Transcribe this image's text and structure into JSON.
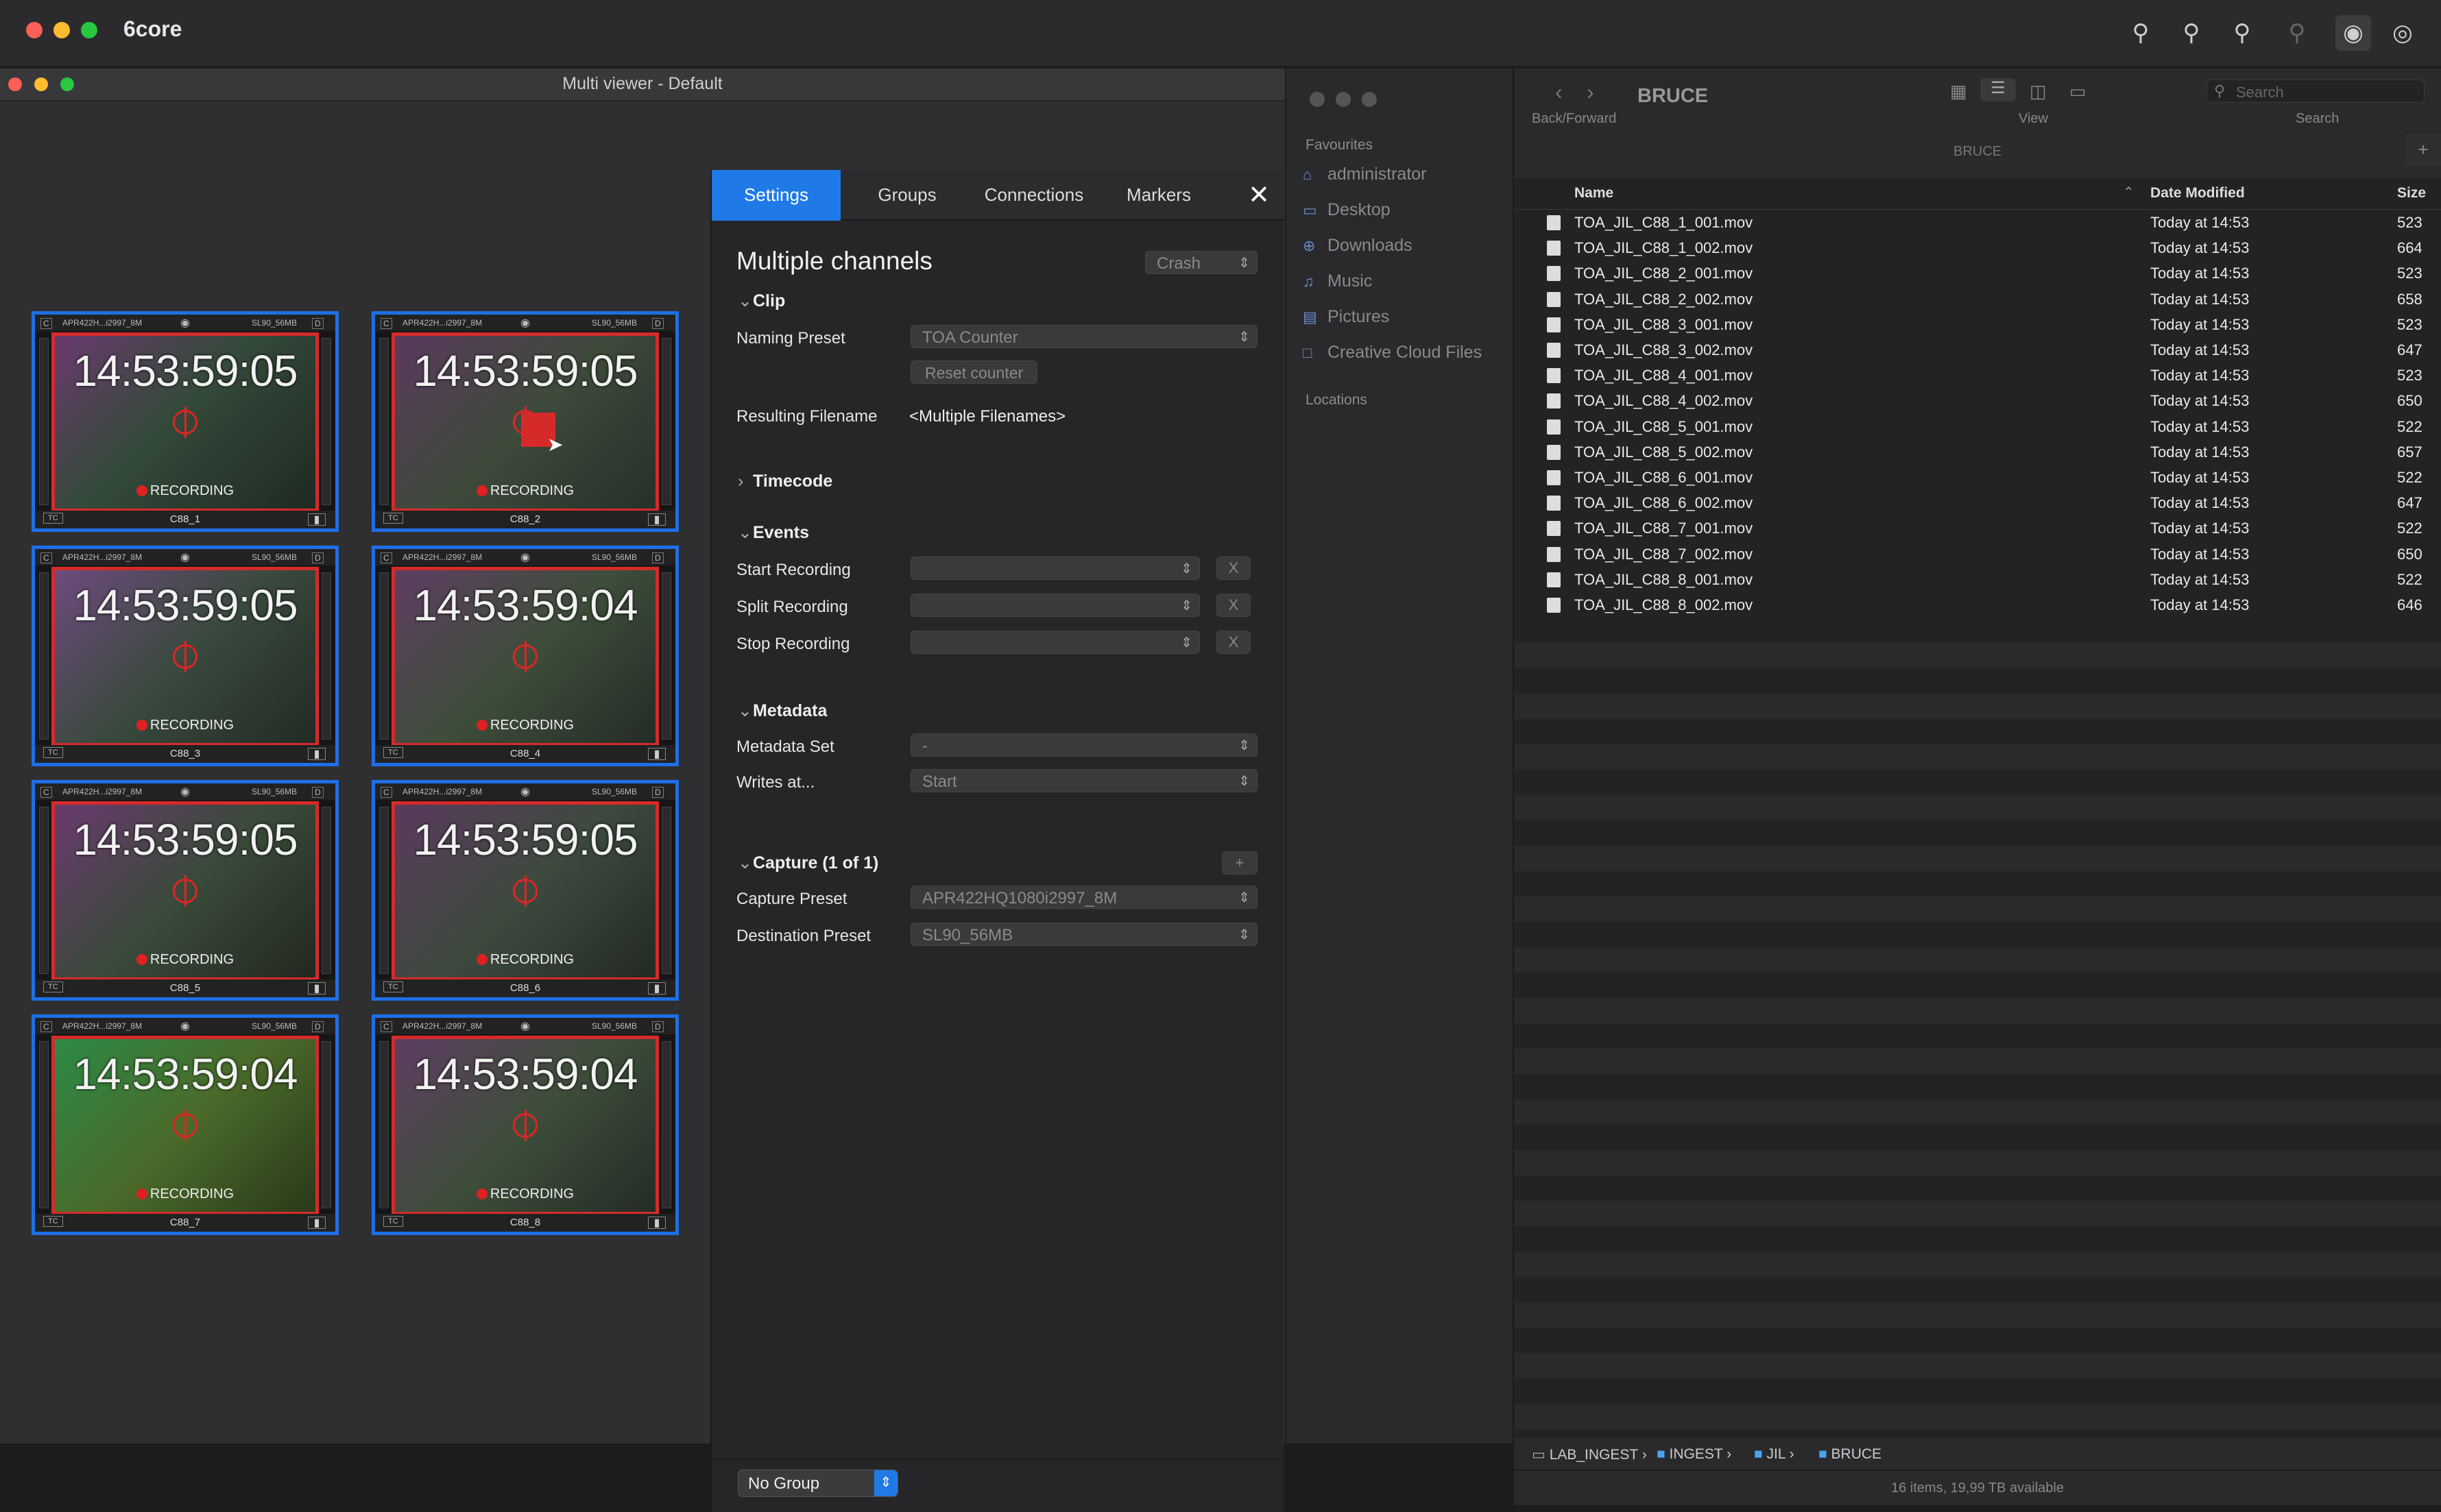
{
  "app": {
    "name": "6core"
  },
  "colors": {
    "accent": "#1f7ae8",
    "recording": "#d62a2a",
    "tile_border": "#1e6fe6"
  },
  "toolbar_icons": [
    "zoom-out-icon",
    "zoom-in-icon",
    "zoom-in-alt-icon",
    "zoom-out-alt-icon",
    "fingerprint-icon",
    "binoculars-icon"
  ],
  "multiviewer": {
    "title": "Multi viewer - Default",
    "tiles": [
      {
        "preset": "APR422H...i2997_8M",
        "dest": "SL90_56MB",
        "badge": "D",
        "timecode": "14:53:59:05",
        "status": "RECORDING",
        "name": "C88_1",
        "tc_label": "TC"
      },
      {
        "preset": "APR422H...i2997_8M",
        "dest": "SL90_56MB",
        "badge": "D",
        "timecode": "14:53:59:05",
        "status": "RECORDING",
        "name": "C88_2",
        "tc_label": "TC"
      },
      {
        "preset": "APR422H...i2997_8M",
        "dest": "SL90_56MB",
        "badge": "D",
        "timecode": "14:53:59:05",
        "status": "RECORDING",
        "name": "C88_3",
        "tc_label": "TC"
      },
      {
        "preset": "APR422H...i2997_8M",
        "dest": "SL90_56MB",
        "badge": "D",
        "timecode": "14:53:59:04",
        "status": "RECORDING",
        "name": "C88_4",
        "tc_label": "TC"
      },
      {
        "preset": "APR422H...i2997_8M",
        "dest": "SL90_56MB",
        "badge": "D",
        "timecode": "14:53:59:05",
        "status": "RECORDING",
        "name": "C88_5",
        "tc_label": "TC"
      },
      {
        "preset": "APR422H...i2997_8M",
        "dest": "SL90_56MB",
        "badge": "D",
        "timecode": "14:53:59:05",
        "status": "RECORDING",
        "name": "C88_6",
        "tc_label": "TC"
      },
      {
        "preset": "APR422H...i2997_8M",
        "dest": "SL90_56MB",
        "badge": "D",
        "timecode": "14:53:59:04",
        "status": "RECORDING",
        "name": "C88_7",
        "tc_label": "TC"
      },
      {
        "preset": "APR422H...i2997_8M",
        "dest": "SL90_56MB",
        "badge": "D",
        "timecode": "14:53:59:04",
        "status": "RECORDING",
        "name": "C88_8",
        "tc_label": "TC"
      }
    ]
  },
  "settings": {
    "tabs": [
      "Settings",
      "Groups",
      "Connections",
      "Markers"
    ],
    "title": "Multiple channels",
    "crash_select": "Crash",
    "clip": {
      "header": "Clip",
      "naming_preset_label": "Naming Preset",
      "naming_preset_value": "TOA Counter",
      "reset_counter": "Reset counter",
      "resulting_filename_label": "Resulting Filename",
      "resulting_filename_value": "<Multiple Filenames>"
    },
    "timecode": {
      "header": "Timecode"
    },
    "events": {
      "header": "Events",
      "start": "Start Recording",
      "split": "Split Recording",
      "stop": "Stop Recording",
      "clear": "X"
    },
    "metadata": {
      "header": "Metadata",
      "set_label": "Metadata Set",
      "set_value": "-",
      "writes_label": "Writes at...",
      "writes_value": "Start"
    },
    "capture": {
      "header": "Capture (1 of 1)",
      "add": "+",
      "capture_preset_label": "Capture Preset",
      "capture_preset_value": "APR422HQ1080i2997_8M",
      "dest_preset_label": "Destination Preset",
      "dest_preset_value": "SL90_56MB"
    },
    "group": "No Group"
  },
  "finder": {
    "folder": "BRUCE",
    "back_forward": "Back/Forward",
    "view": "View",
    "search_label": "Search",
    "search_placeholder": "Search",
    "path_title": "BRUCE",
    "sidebar": {
      "favourites": "Favourites",
      "items": [
        "administrator",
        "Desktop",
        "Downloads",
        "Music",
        "Pictures",
        "Creative Cloud Files"
      ],
      "locations": "Locations"
    },
    "columns": {
      "name": "Name",
      "date": "Date Modified",
      "size": "Size"
    },
    "files": [
      {
        "name": "TOA_JIL_C88_1_001.mov",
        "date": "Today at 14:53",
        "size": "523"
      },
      {
        "name": "TOA_JIL_C88_1_002.mov",
        "date": "Today at 14:53",
        "size": "664"
      },
      {
        "name": "TOA_JIL_C88_2_001.mov",
        "date": "Today at 14:53",
        "size": "523"
      },
      {
        "name": "TOA_JIL_C88_2_002.mov",
        "date": "Today at 14:53",
        "size": "658"
      },
      {
        "name": "TOA_JIL_C88_3_001.mov",
        "date": "Today at 14:53",
        "size": "523"
      },
      {
        "name": "TOA_JIL_C88_3_002.mov",
        "date": "Today at 14:53",
        "size": "647"
      },
      {
        "name": "TOA_JIL_C88_4_001.mov",
        "date": "Today at 14:53",
        "size": "523"
      },
      {
        "name": "TOA_JIL_C88_4_002.mov",
        "date": "Today at 14:53",
        "size": "650"
      },
      {
        "name": "TOA_JIL_C88_5_001.mov",
        "date": "Today at 14:53",
        "size": "522"
      },
      {
        "name": "TOA_JIL_C88_5_002.mov",
        "date": "Today at 14:53",
        "size": "657"
      },
      {
        "name": "TOA_JIL_C88_6_001.mov",
        "date": "Today at 14:53",
        "size": "522"
      },
      {
        "name": "TOA_JIL_C88_6_002.mov",
        "date": "Today at 14:53",
        "size": "647"
      },
      {
        "name": "TOA_JIL_C88_7_001.mov",
        "date": "Today at 14:53",
        "size": "522"
      },
      {
        "name": "TOA_JIL_C88_7_002.mov",
        "date": "Today at 14:53",
        "size": "650"
      },
      {
        "name": "TOA_JIL_C88_8_001.mov",
        "date": "Today at 14:53",
        "size": "522"
      },
      {
        "name": "TOA_JIL_C88_8_002.mov",
        "date": "Today at 14:53",
        "size": "646"
      }
    ],
    "path": [
      "LAB_INGEST",
      "INGEST",
      "JIL",
      "BRUCE"
    ],
    "status": "16 items, 19,99 TB available"
  }
}
